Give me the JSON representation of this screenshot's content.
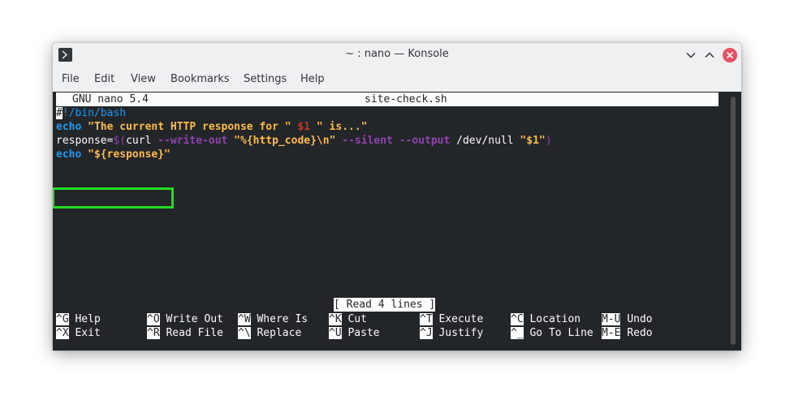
{
  "window": {
    "title": "~ : nano — Konsole"
  },
  "menu": [
    "File",
    "Edit",
    "View",
    "Bookmarks",
    "Settings",
    "Help"
  ],
  "nano": {
    "version": "GNU nano 5.4",
    "filename": "site-check.sh",
    "status": "[ Read 4 lines ]"
  },
  "code": {
    "line1_cursor": "#",
    "line1_rest": "!/bin/bash",
    "line2_cmd": "echo",
    "line2_str1": "\"The current HTTP response for \"",
    "line2_var": "$1",
    "line2_str2": "\" is...\"",
    "line3_a": "response=",
    "line3_b": "$(",
    "line3_c": "curl ",
    "line3_d": "--write-out",
    "line3_e": "\"%{http_code}\\n\"",
    "line3_f": "--silent",
    "line3_g": "--output",
    "line3_h": "/dev/null ",
    "line3_i": "\"$1\"",
    "line3_j": ")",
    "line4_cmd": "echo",
    "line4_str": "\"${response}\""
  },
  "shortcuts": [
    {
      "key": "^G",
      "label": "Help"
    },
    {
      "key": "^O",
      "label": "Write Out"
    },
    {
      "key": "^W",
      "label": "Where Is"
    },
    {
      "key": "^K",
      "label": "Cut"
    },
    {
      "key": "^T",
      "label": "Execute"
    },
    {
      "key": "^C",
      "label": "Location"
    },
    {
      "key": "M-U",
      "label": "Undo"
    },
    {
      "key": "^X",
      "label": "Exit"
    },
    {
      "key": "^R",
      "label": "Read File"
    },
    {
      "key": "^\\",
      "label": "Replace"
    },
    {
      "key": "^U",
      "label": "Paste"
    },
    {
      "key": "^J",
      "label": "Justify"
    },
    {
      "key": "^_",
      "label": "Go To Line"
    },
    {
      "key": "M-E",
      "label": "Redo"
    }
  ],
  "colors": {
    "highlight": "#22dd22",
    "terminal_bg": "#232629",
    "accent": "#1d99f3"
  }
}
